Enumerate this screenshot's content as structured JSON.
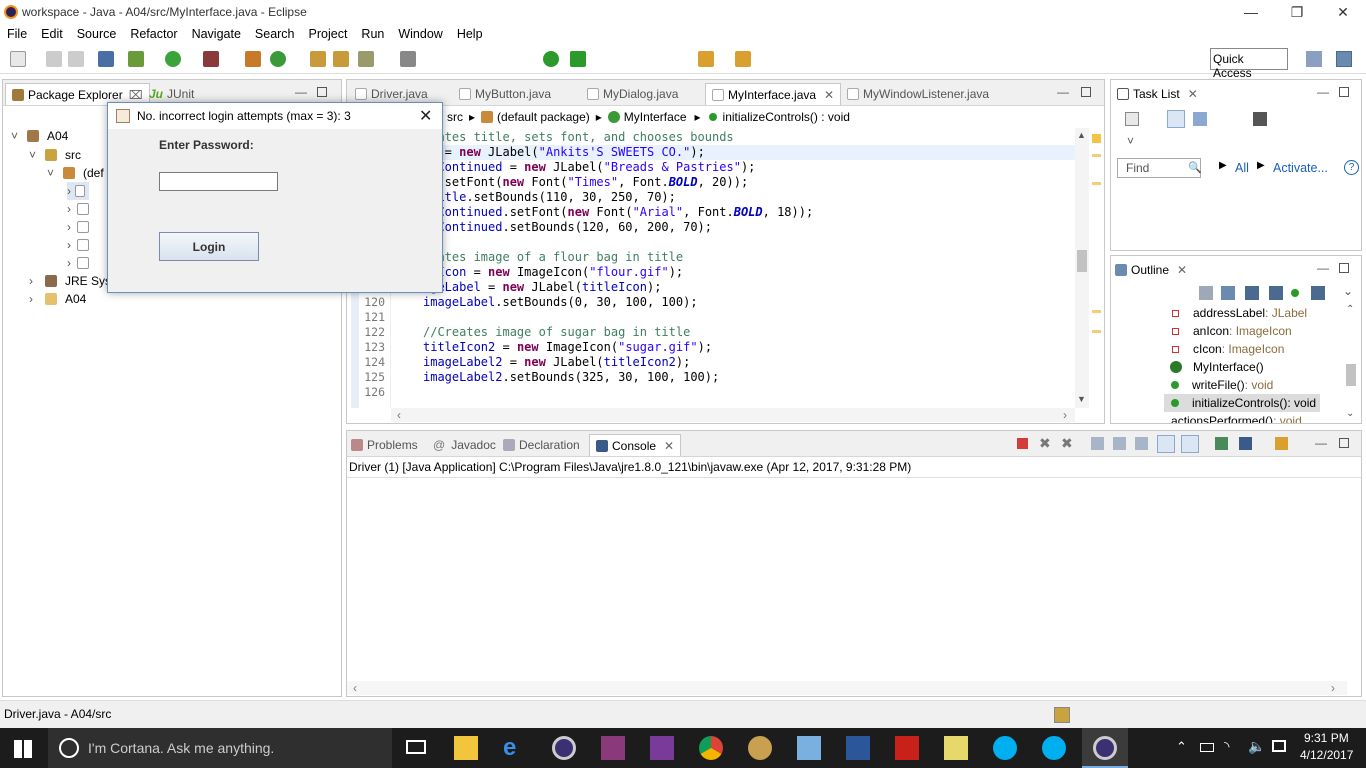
{
  "window": {
    "title": "workspace - Java - A04/src/MyInterface.java - Eclipse"
  },
  "menu": [
    "File",
    "Edit",
    "Source",
    "Refactor",
    "Navigate",
    "Search",
    "Project",
    "Run",
    "Window",
    "Help"
  ],
  "quick_access": "Quick Access",
  "left_panel": {
    "tabs": [
      "Package Explorer",
      "JUnit"
    ],
    "tree": {
      "project": "A04",
      "src": "src",
      "pkg": "(def",
      "jre": "JRE Syst",
      "folder": "A04"
    }
  },
  "editor": {
    "tabs": [
      "Driver.java",
      "MyButton.java",
      "MyDialog.java",
      "MyInterface.java",
      "MyWindowListener.java"
    ],
    "breadcrumb": [
      "src",
      "(default package)",
      "MyInterface",
      "initializeControls() : void"
    ],
    "line_numbers": [
      "120",
      "121",
      "122",
      "123",
      "124",
      "125",
      "126"
    ]
  },
  "task_list": {
    "title": "Task List",
    "find_placeholder": "Find",
    "all": "All",
    "activate": "Activate..."
  },
  "outline": {
    "title": "Outline",
    "items": [
      {
        "name": "addressLabel",
        "type": " : JLabel"
      },
      {
        "name": "anIcon",
        "type": " : ImageIcon"
      },
      {
        "name": "cIcon",
        "type": " : ImageIcon"
      },
      {
        "name": "MyInterface()",
        "type": ""
      },
      {
        "name": "writeFile()",
        "type": " : void"
      },
      {
        "name": "initializeControls()",
        "type": " : void"
      },
      {
        "name": "actionsPerformed()",
        "type": " : void"
      }
    ]
  },
  "console": {
    "tabs": [
      "Problems",
      "Javadoc",
      "Declaration",
      "Console"
    ],
    "launch": "Driver (1) [Java Application] C:\\Program Files\\Java\\jre1.8.0_121\\bin\\javaw.exe (Apr 12, 2017, 9:31:28 PM)"
  },
  "status_bar": {
    "text": "Driver.java - A04/src"
  },
  "dialog": {
    "title": "No. incorrect login attempts (max = 3): 3",
    "label": "Enter Password:",
    "button": "Login"
  },
  "taskbar": {
    "search": "I'm Cortana. Ask me anything.",
    "time": "9:31 PM",
    "date": "4/12/2017"
  }
}
